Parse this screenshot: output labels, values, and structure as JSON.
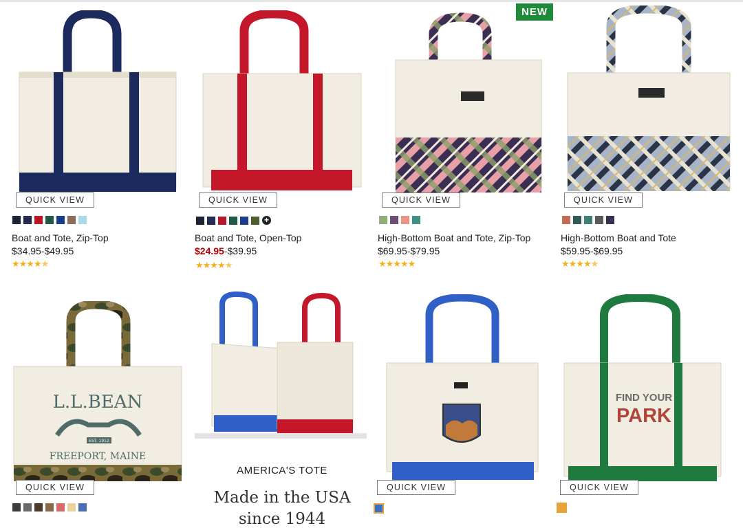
{
  "badge_new": "NEW",
  "quick_view_label": "QUICK VIEW",
  "products": [
    {
      "name": "Boat and Tote, Zip-Top",
      "price": "$34.95-$49.95",
      "rating": 4.5,
      "swatches": [
        "#1d2235",
        "#232b52",
        "#b8182a",
        "#1f5a45",
        "#1b3d8f",
        "#8a6d5a",
        "#a9dbe0"
      ]
    },
    {
      "name": "Boat and Tote, Open-Top",
      "price_sale": "$24.95",
      "price_rest": "-$39.95",
      "rating": 4.5,
      "swatches": [
        "#1d2235",
        "#232b52",
        "#b8182a",
        "#1f5a45",
        "#1b3d8f",
        "#4e5f2f"
      ],
      "more_colors": "+"
    },
    {
      "name": "High-Bottom Boat and Tote, Zip-Top",
      "price": "$69.95-$79.95",
      "rating": 5,
      "swatches": [
        "#8fae7a",
        "#6d4e6e",
        "#e8948b",
        "#3f8f87"
      ]
    },
    {
      "name": "High-Bottom Boat and Tote",
      "price": "$59.95-$69.95",
      "rating": 4.5,
      "swatches": [
        "#c46b5a",
        "#315a5a",
        "#3e7e73",
        "#5a5a5a",
        "#3a2f4f"
      ]
    },
    {
      "swatches": [
        "#3b3b3b",
        "#6b6b6b",
        "#4a3b2a",
        "#8a6a4a",
        "#d96a6a",
        "#e8d49a",
        "#4b6fb5"
      ]
    },
    {
      "swatches": [
        "#3a6fc7"
      ]
    },
    {
      "swatches": [
        "#e8a23a"
      ]
    }
  ],
  "promo": {
    "title": "AMERICA'S TOTE",
    "subtitle": "Made in the USA",
    "subtitle2": "since 1944"
  },
  "tote_prints": {
    "llbean_logo": "L.L.BEAN",
    "est": "EST. 1912",
    "location": "FREEPORT, MAINE",
    "park_line1": "FIND YOUR",
    "park_line2": "PARK"
  },
  "colors": {
    "navy": "#1c2a5e",
    "red": "#c4182a",
    "green": "#1e7a3e",
    "canvas": "#f1ede2",
    "blue": "#2f5fc7"
  }
}
